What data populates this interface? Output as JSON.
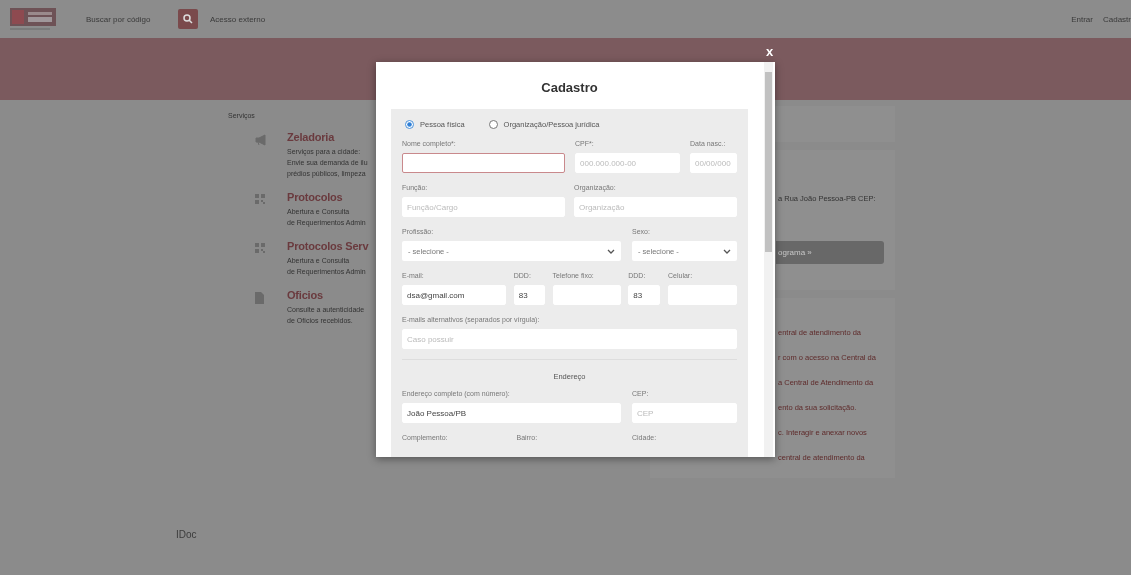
{
  "header": {
    "search": {
      "placeholder": "Buscar por código"
    },
    "external_link": "Acesso externo",
    "login": "Entrar",
    "register": "Cadastr"
  },
  "services": {
    "heading": "Serviços",
    "items": [
      {
        "kind": "megaphone",
        "title": "Zeladoria",
        "lines": [
          "Serviços para a cidade:",
          "Envie sua demanda de ilu",
          "prédios públicos, limpeza"
        ]
      },
      {
        "kind": "qr",
        "title": "Protocolos",
        "lines": [
          "Abertura e Consulta",
          "de Requerimentos Admin"
        ]
      },
      {
        "kind": "qr",
        "title": "Protocolos Serv",
        "lines": [
          "Abertura e Consulta",
          "de Requerimentos Admin"
        ]
      },
      {
        "kind": "document",
        "title": "Oficios",
        "lines": [
          "Consulte a autenticidade",
          "de Ofícios recebidos."
        ]
      }
    ]
  },
  "side_panel": {
    "address": "a Rua João Pessoa-PB CEP:",
    "button": "ograma »",
    "links": [
      "entral de atendimento da",
      "r com o acesso na Central da",
      "a Central de Atendimento da",
      "ento da sua solicitação.",
      "c. Interagir e anexar novos",
      "central de atendimento da"
    ]
  },
  "footer": "IDoc",
  "modal": {
    "title": "Cadastro",
    "close": "x",
    "person_types": [
      {
        "label": "Pessoa física",
        "selected": true
      },
      {
        "label": "Organização/Pessoa jurídica",
        "selected": false
      }
    ],
    "rows": [
      {
        "fields": [
          {
            "label": "Nome completo*:",
            "kind": "text",
            "invalid": true
          },
          {
            "label": "CPF*:",
            "kind": "text",
            "placeholder": "000.000.000-00",
            "invalid": false
          },
          {
            "label": "Data nasc.:",
            "kind": "text",
            "placeholder": "00/00/000",
            "invalid": false
          }
        ]
      },
      {
        "fields": [
          {
            "label": "Função:",
            "kind": "text",
            "placeholder": "Função/Cargo",
            "invalid": false
          },
          {
            "label": "Organização:",
            "kind": "text",
            "placeholder": "Organização",
            "invalid": false
          }
        ]
      },
      {
        "fields": [
          {
            "label": "Profissão:",
            "kind": "select",
            "value": "- selecione -",
            "invalid": false
          },
          {
            "label": "Sexo:",
            "kind": "select",
            "value": "- selecione -",
            "invalid": false
          }
        ]
      },
      {
        "fields": [
          {
            "label": "E-mail:",
            "kind": "text",
            "value": "dsa@gmail.com",
            "invalid": false
          },
          {
            "label": "DDD:",
            "kind": "text",
            "value": "83",
            "invalid": false
          },
          {
            "label": "Telefone fixo:",
            "kind": "text",
            "invalid": false
          },
          {
            "label": "DDD:",
            "kind": "text",
            "value": "83",
            "invalid": false
          },
          {
            "label": "Celular:",
            "kind": "text",
            "invalid": false
          }
        ]
      },
      {
        "fields": [
          {
            "label": "E-mails alternativos (separados por vírgula):",
            "kind": "text",
            "placeholder": "Caso possuir",
            "invalid": false
          }
        ]
      },
      {
        "fields": [
          {
            "label": "Endereço",
            "kind": "section"
          }
        ]
      },
      {
        "fields": [
          {
            "label": "Endereço completo (com número):",
            "kind": "text",
            "value": "João Pessoa/PB",
            "invalid": false
          },
          {
            "label": "CEP:",
            "kind": "text",
            "placeholder": "CEP",
            "invalid": false
          }
        ]
      },
      {
        "fields": [
          {
            "label": "Complemento:",
            "kind": "cut"
          },
          {
            "label": "Bairro:",
            "kind": "cut"
          },
          {
            "label": "Cidade:",
            "kind": "cut"
          }
        ]
      }
    ]
  }
}
